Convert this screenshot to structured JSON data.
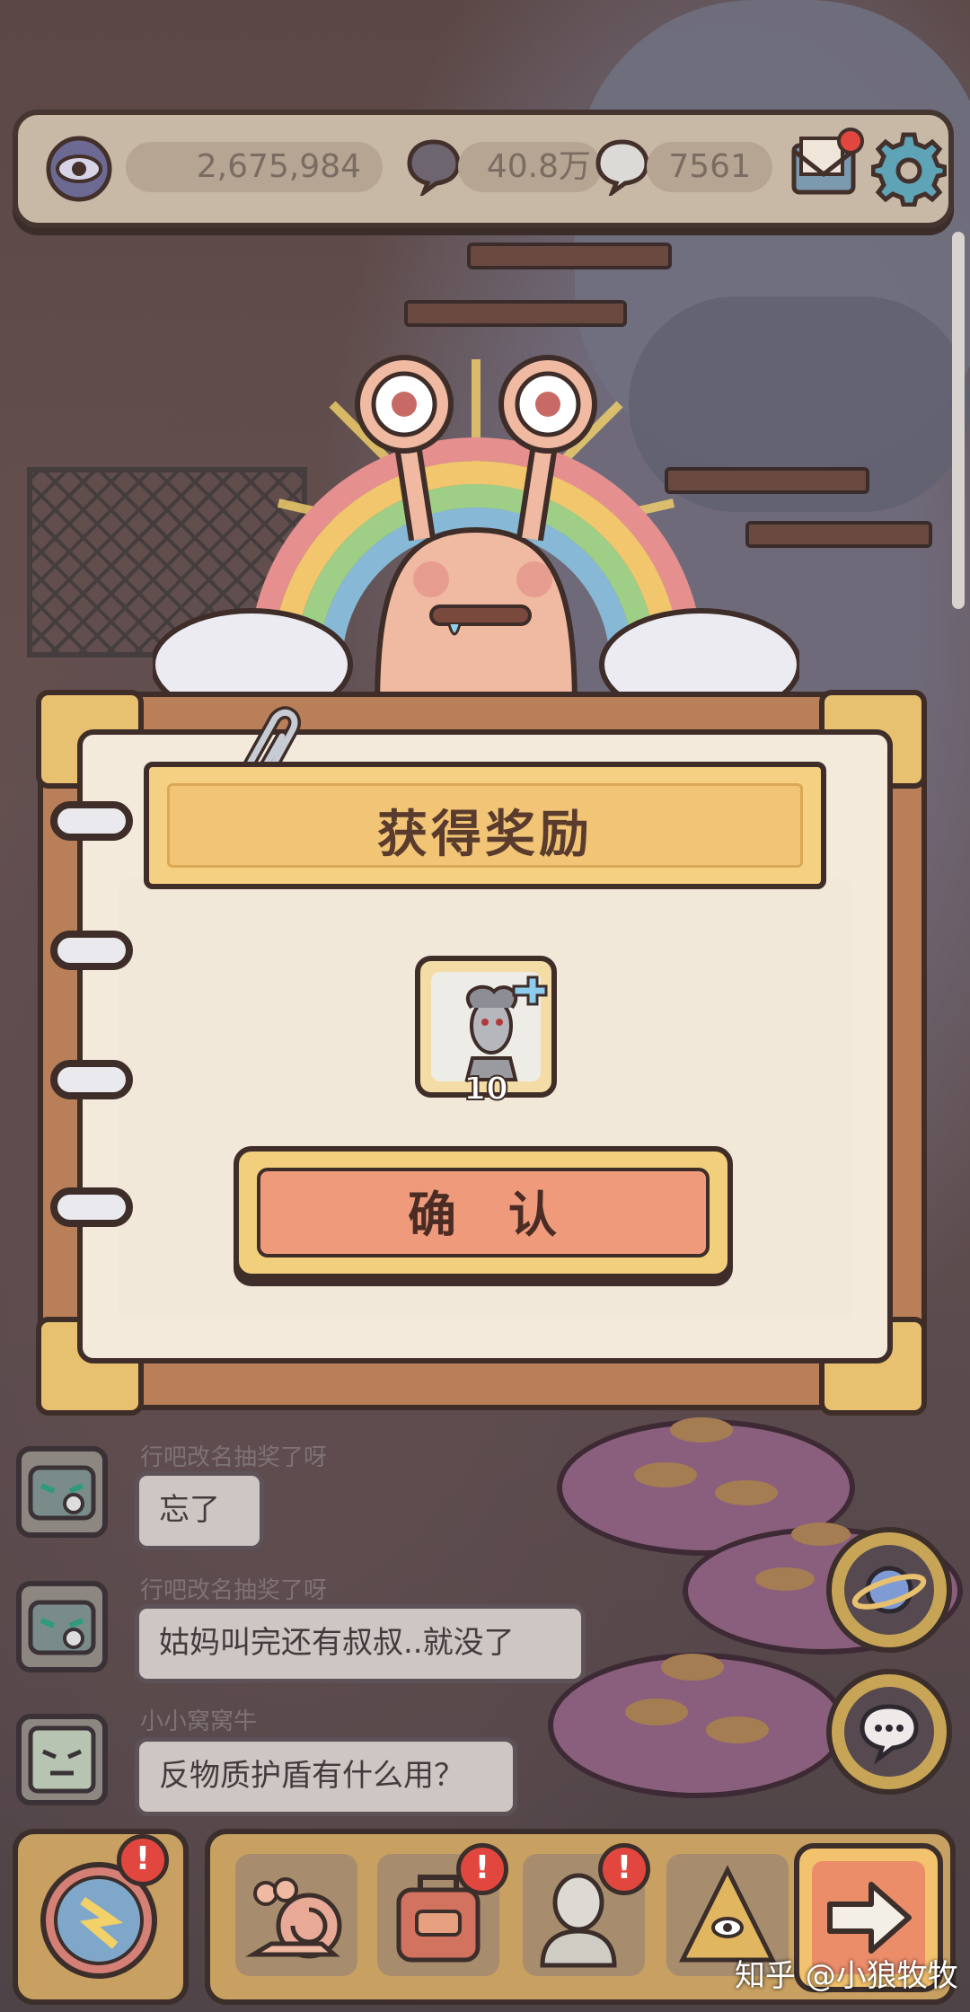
{
  "top_bar": {
    "views": "2,675,984",
    "stat_two": "40.8万",
    "stat_three": "7561"
  },
  "dialog": {
    "title": "获得奖励",
    "reward_count": "10",
    "confirm_label": "确　认"
  },
  "chat": [
    {
      "name": "行吧改名抽奖了呀",
      "message": "忘了"
    },
    {
      "name": "行吧改名抽奖了呀",
      "message": "姑妈叫完还有叔叔..就没了"
    },
    {
      "name": "小小窝窝牛",
      "message": "反物质护盾有什么用？"
    }
  ],
  "bottom_bar": {
    "badge_mark": "!"
  },
  "watermark": "知乎 @小狼牧牧",
  "colors": {
    "accent_red": "#e2473f",
    "gold": "#f1cf7d",
    "confirm": "#ee9a7b"
  }
}
